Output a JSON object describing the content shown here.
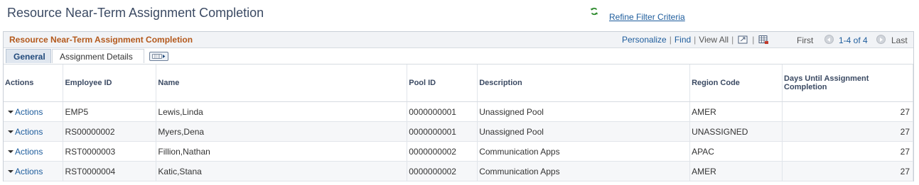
{
  "page": {
    "title": "Resource Near-Term Assignment Completion",
    "refine_link": "Refine Filter Criteria"
  },
  "grid": {
    "title": "Resource Near-Term Assignment Completion",
    "nav": {
      "personalize": "Personalize",
      "find": "Find",
      "view_all": "View All",
      "first": "First",
      "range": "1-4 of 4",
      "last": "Last"
    },
    "tabs": [
      {
        "label": "General",
        "active": true
      },
      {
        "label": "Assignment Details",
        "active": false
      }
    ],
    "columns": [
      "Actions",
      "Employee ID",
      "Name",
      "Pool ID",
      "Description",
      "Region Code",
      "Days Until Assignment Completion"
    ],
    "rows": [
      {
        "action": "Actions",
        "employee_id": "EMP5",
        "name": "Lewis,Linda",
        "pool_id": "0000000001",
        "description": "Unassigned Pool",
        "region": "AMER",
        "days": "27"
      },
      {
        "action": "Actions",
        "employee_id": "RS00000002",
        "name": "Myers,Dena",
        "pool_id": "0000000001",
        "description": "Unassigned Pool",
        "region": "UNASSIGNED",
        "days": "27"
      },
      {
        "action": "Actions",
        "employee_id": "RST0000003",
        "name": "Fillion,Nathan",
        "pool_id": "0000000002",
        "description": "Communication Apps",
        "region": "APAC",
        "days": "27"
      },
      {
        "action": "Actions",
        "employee_id": "RST0000004",
        "name": "Katic,Stana",
        "pool_id": "0000000002",
        "description": "Communication Apps",
        "region": "AMER",
        "days": "27"
      }
    ]
  },
  "colors": {
    "grid_title": "#b3581b",
    "link": "#1d5c9c",
    "refresh_icon": "#2e8b2e"
  },
  "icons": [
    "refresh-icon",
    "zoom-window-icon",
    "download-grid-icon",
    "prev-arrow-icon",
    "next-arrow-icon",
    "show-all-columns-icon",
    "dropdown-caret-icon"
  ]
}
